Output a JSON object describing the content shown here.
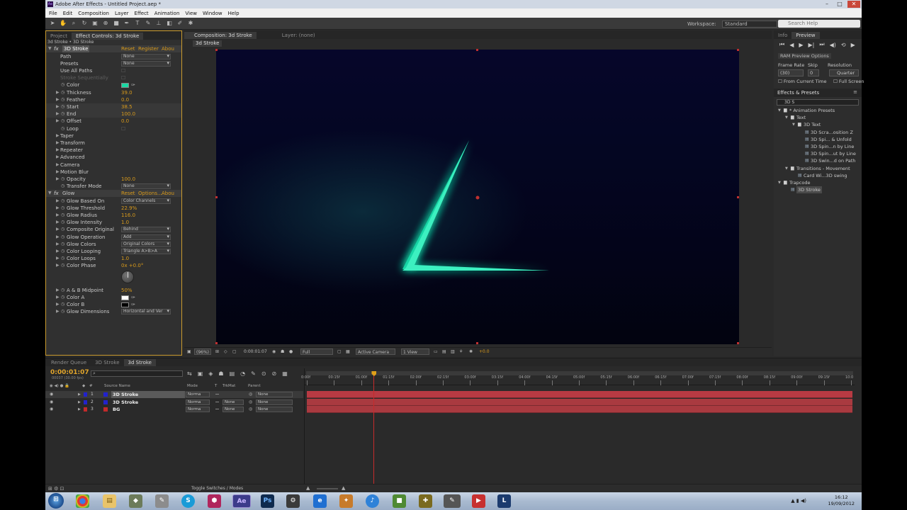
{
  "window": {
    "title": "Adobe After Effects - Untitled Project.aep *",
    "logo_text": "Ae"
  },
  "menu": [
    "File",
    "Edit",
    "Composition",
    "Layer",
    "Effect",
    "Animation",
    "View",
    "Window",
    "Help"
  ],
  "toolbar": {
    "workspace_label": "Workspace:",
    "workspace_value": "Standard",
    "search_placeholder": "Search Help"
  },
  "left_panel": {
    "tabs": [
      "Project",
      "Effect Controls: 3d Stroke"
    ],
    "breadcrumb": "3d Stroke • 3D Stroke",
    "effect1": {
      "name": "3D Stroke",
      "reset": "Reset",
      "register": "Register",
      "about": "Abou"
    },
    "rows": [
      {
        "label": "Path",
        "ddl": "None"
      },
      {
        "label": "Presets",
        "ddl": "None"
      },
      {
        "label": "Use All Paths",
        "val": ""
      },
      {
        "label": "Stroke Sequentially",
        "val": ""
      },
      {
        "label": "Color",
        "swatch": "#19d9a4"
      },
      {
        "label": "Thickness",
        "val": "39.0"
      },
      {
        "label": "Feather",
        "val": "0.0"
      },
      {
        "label": "Start",
        "val": "38.5"
      },
      {
        "label": "End",
        "val": "100.0"
      },
      {
        "label": "Offset",
        "val": "0.0"
      },
      {
        "label": "Loop",
        "val": ""
      },
      {
        "label": "Taper"
      },
      {
        "label": "Transform"
      },
      {
        "label": "Repeater"
      },
      {
        "label": "Advanced"
      },
      {
        "label": "Camera"
      },
      {
        "label": "Motion Blur"
      },
      {
        "label": "Opacity",
        "val": "100.0"
      },
      {
        "label": "Transfer Mode",
        "ddl": "None"
      }
    ],
    "effect2": {
      "name": "Glow",
      "reset": "Reset",
      "options": "Options...",
      "about": "Abou"
    },
    "glow_rows": [
      {
        "label": "Glow Based On",
        "ddl": "Color Channels"
      },
      {
        "label": "Glow Threshold",
        "val": "22.9%"
      },
      {
        "label": "Glow Radius",
        "val": "116.0"
      },
      {
        "label": "Glow Intensity",
        "val": "1.0"
      },
      {
        "label": "Composite Original",
        "ddl": "Behind"
      },
      {
        "label": "Glow Operation",
        "ddl": "Add"
      },
      {
        "label": "Glow Colors",
        "ddl": "Original Colors"
      },
      {
        "label": "Color Looping",
        "ddl": "Triangle A>B>A"
      },
      {
        "label": "Color Loops",
        "val": "1.0"
      },
      {
        "label": "Color Phase",
        "val": "0x +0.0°"
      },
      {
        "label": "A & B Midpoint",
        "val": "50%"
      },
      {
        "label": "Color A",
        "swatch": "#ffffff"
      },
      {
        "label": "Color B",
        "swatch": "#000000"
      },
      {
        "label": "Glow Dimensions",
        "ddl": "Horizontal and Ver"
      }
    ]
  },
  "comp": {
    "tab": "Composition: 3d Stroke",
    "layer_tab": "Layer: (none)",
    "breadcrumb": "3d Stroke",
    "zoom": "(96%)",
    "timecode": "0:00:01:07",
    "resolution": "Full",
    "camera": "Active Camera",
    "views": "1 View",
    "exposure": "+0.0"
  },
  "right": {
    "tabs": [
      "Info",
      "Preview"
    ],
    "ram_preview": "RAM Preview Options",
    "frame_rate_label": "Frame Rate",
    "skip_label": "Skip",
    "resolution_label": "Resolution",
    "frame_rate": "(30)",
    "skip": "0",
    "resolution": "Quarter",
    "from_current": "From Current Time",
    "full_screen": "Full Screen",
    "effects_title": "Effects & Presets",
    "search_value": "3D S",
    "tree": [
      {
        "label": "* Animation Presets",
        "indent": 0
      },
      {
        "label": "Text",
        "indent": 1
      },
      {
        "label": "3D Text",
        "indent": 2
      },
      {
        "label": "3D Scra...osition Z",
        "indent": 3
      },
      {
        "label": "3D Spi... & Unfold",
        "indent": 3
      },
      {
        "label": "3D Spin...n by Line",
        "indent": 3
      },
      {
        "label": "3D Spin...ut by Line",
        "indent": 3
      },
      {
        "label": "3D Swin...d on Path",
        "indent": 3
      },
      {
        "label": "Transitions - Movement",
        "indent": 1
      },
      {
        "label": "Card Wi...3D swing",
        "indent": 2
      },
      {
        "label": "Trapcode",
        "indent": 0
      },
      {
        "label": "3D Stroke",
        "indent": 1
      }
    ]
  },
  "timeline": {
    "tabs": [
      "Render Queue",
      "3D Stroke",
      "3d Stroke"
    ],
    "timecode": "0:00:01:07",
    "frame_info": "00037 (30.00 fps)",
    "search_placeholder": "",
    "columns": {
      "source": "Source Name",
      "mode": "Mode",
      "t": "T",
      "trkmat": "TrkMat",
      "parent": "Parent"
    },
    "layers": [
      {
        "num": "1",
        "name": "3D Stroke",
        "mode": "Norma",
        "trkmat": "",
        "parent": "None",
        "color": "#2222cc"
      },
      {
        "num": "2",
        "name": "3D Stroke",
        "mode": "Norma",
        "trkmat": "None",
        "parent": "None",
        "color": "#2222cc"
      },
      {
        "num": "3",
        "name": "BG",
        "mode": "Norma",
        "trkmat": "None",
        "parent": "None",
        "color": "#c22a2a"
      }
    ],
    "ruler": [
      "0:00f",
      "00:15f",
      "01:00f",
      "01:15f",
      "02:00f",
      "02:15f",
      "03:00f",
      "03:15f",
      "04:00f",
      "04:15f",
      "05:00f",
      "05:15f",
      "06:00f",
      "06:15f",
      "07:00f",
      "07:15f",
      "08:00f",
      "08:15f",
      "09:00f",
      "09:15f",
      "10:0"
    ],
    "toggle_label": "Toggle Switches / Modes",
    "playhead_seconds": 1.23,
    "duration_seconds": 10
  },
  "taskbar": {
    "time": "16:12",
    "date": "19/09/2012",
    "apps": [
      "start",
      "chrome",
      "explorer",
      "app3",
      "app4",
      "skype",
      "app6",
      "after-effects",
      "photoshop",
      "steam",
      "ie",
      "app11",
      "itunes",
      "minecraft",
      "app14",
      "app15",
      "app16",
      "app17",
      "app18"
    ]
  }
}
